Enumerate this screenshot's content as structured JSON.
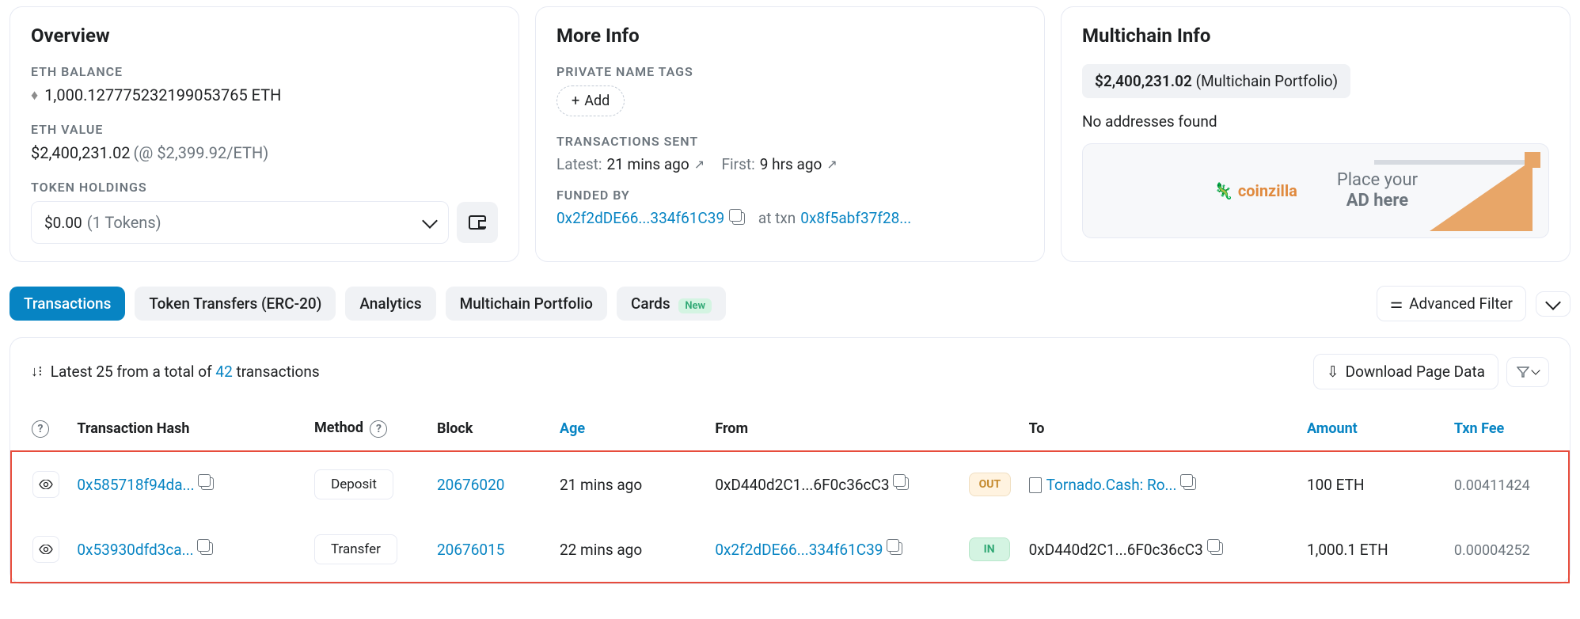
{
  "overview": {
    "title": "Overview",
    "eth_balance_label": "ETH BALANCE",
    "eth_balance_value": "1,000.127775232199053765 ETH",
    "eth_value_label": "ETH VALUE",
    "eth_value_main": "$2,400,231.02",
    "eth_value_sub": "(@ $2,399.92/ETH)",
    "token_holdings_label": "TOKEN HOLDINGS",
    "token_amount": "$0.00",
    "token_count": "(1 Tokens)"
  },
  "more_info": {
    "title": "More Info",
    "private_tags_label": "PRIVATE NAME TAGS",
    "add_label": "Add",
    "tx_sent_label": "TRANSACTIONS SENT",
    "latest_label": "Latest:",
    "latest_value": "21 mins ago",
    "first_label": "First:",
    "first_value": "9 hrs ago",
    "funded_by_label": "FUNDED BY",
    "funded_by_addr": "0x2f2dDE66...334f61C39",
    "at_txn_label": "at txn",
    "funded_by_txn": "0x8f5abf37f28..."
  },
  "multichain": {
    "title": "Multichain Info",
    "portfolio_amount": "$2,400,231.02",
    "portfolio_label": "(Multichain Portfolio)",
    "no_addresses": "No addresses found",
    "ad_brand": "coinzilla",
    "ad_line1": "Place your",
    "ad_line2": "AD here"
  },
  "tabs": {
    "transactions": "Transactions",
    "token_transfers": "Token Transfers (ERC-20)",
    "analytics": "Analytics",
    "multichain_portfolio": "Multichain Portfolio",
    "cards": "Cards",
    "new_badge": "New",
    "advanced_filter": "Advanced Filter"
  },
  "table_meta": {
    "summary_prefix": "Latest 25 from a total of ",
    "summary_count": "42",
    "summary_suffix": " transactions",
    "download_label": "Download Page Data"
  },
  "columns": {
    "hash": "Transaction Hash",
    "method": "Method",
    "block": "Block",
    "age": "Age",
    "from": "From",
    "to": "To",
    "amount": "Amount",
    "fee": "Txn Fee"
  },
  "rows": [
    {
      "hash": "0x585718f94da...",
      "method": "Deposit",
      "block": "20676020",
      "age": "21 mins ago",
      "from": "0xD440d2C1...6F0c36cC3",
      "from_link": false,
      "direction": "OUT",
      "to": "Tornado.Cash: Ro...",
      "to_link": true,
      "to_has_doc": true,
      "amount": "100 ETH",
      "fee": "0.00411424"
    },
    {
      "hash": "0x53930dfd3ca...",
      "method": "Transfer",
      "block": "20676015",
      "age": "22 mins ago",
      "from": "0x2f2dDE66...334f61C39",
      "from_link": true,
      "direction": "IN",
      "to": "0xD440d2C1...6F0c36cC3",
      "to_link": false,
      "to_has_doc": false,
      "amount": "1,000.1 ETH",
      "fee": "0.00004252"
    }
  ]
}
